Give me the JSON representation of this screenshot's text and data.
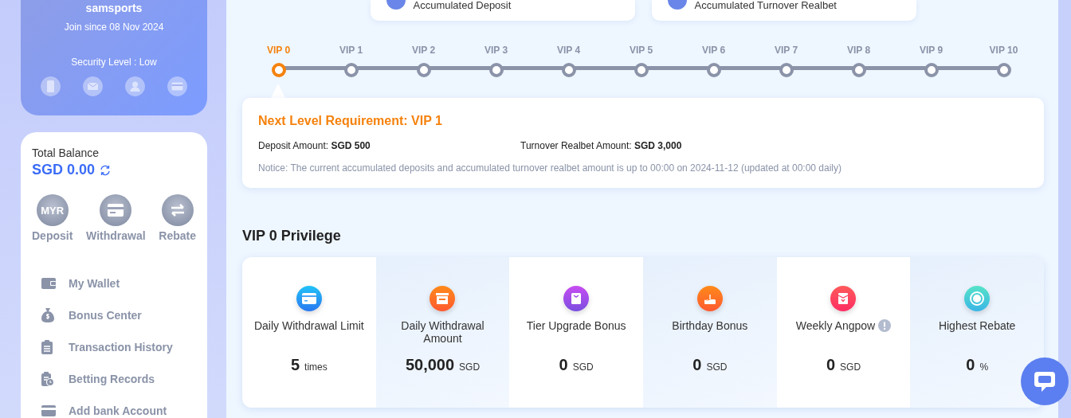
{
  "profile": {
    "username": "samsports",
    "joined": "Join since 08 Nov 2024",
    "security_level": "Security Level : Low"
  },
  "balance": {
    "label": "Total Balance",
    "amount": "SGD 0.00",
    "actions": [
      {
        "kind": "currency",
        "label": "Deposit",
        "badge": "MYR"
      },
      {
        "kind": "card",
        "label": "Withdrawal"
      },
      {
        "kind": "transfer",
        "label": "Rebate"
      }
    ]
  },
  "menu": [
    {
      "kind": "wallet",
      "label": "My Wallet"
    },
    {
      "kind": "moneybag",
      "label": "Bonus Center"
    },
    {
      "kind": "clipboard",
      "label": "Transaction History"
    },
    {
      "kind": "records",
      "label": "Betting Records"
    },
    {
      "kind": "bankcard",
      "label": "Add bank Account"
    }
  ],
  "stat_cards": [
    {
      "label": "Accumulated Deposit"
    },
    {
      "label": "Accumulated Turnover Realbet"
    }
  ],
  "vip_levels": [
    {
      "label": "VIP 0",
      "selected": true
    },
    {
      "label": "VIP 1",
      "selected": false
    },
    {
      "label": "VIP 2",
      "selected": false
    },
    {
      "label": "VIP 3",
      "selected": false
    },
    {
      "label": "VIP 4",
      "selected": false
    },
    {
      "label": "VIP 5",
      "selected": false
    },
    {
      "label": "VIP 6",
      "selected": false
    },
    {
      "label": "VIP 7",
      "selected": false
    },
    {
      "label": "VIP 8",
      "selected": false
    },
    {
      "label": "VIP 9",
      "selected": false
    },
    {
      "label": "VIP 10",
      "selected": false
    }
  ],
  "requirement": {
    "title": "Next Level Requirement: VIP 1",
    "deposit": "Deposit Amount: **SGD 500**",
    "turnover": "Turnover Realbet Amount: **SGD 3,000**",
    "notice": "Notice: The current accumulated deposits and accumulated turnover realbet amount is up to 00:00 on 2024-11-12 (updated at 00:00 daily)"
  },
  "privilege": {
    "title": "VIP 0 Privilege",
    "items": [
      {
        "kind": "card",
        "label": "Daily Withdrawal Limit",
        "value": "5",
        "unit": "times",
        "info": false
      },
      {
        "kind": "box",
        "label": "Daily Withdrawal Amount",
        "value": "50,000",
        "unit": "SGD",
        "info": false
      },
      {
        "kind": "gift",
        "label": "Tier Upgrade Bonus",
        "value": "0",
        "unit": "SGD",
        "info": false
      },
      {
        "kind": "cake",
        "label": "Birthday Bonus",
        "value": "0",
        "unit": "SGD",
        "info": false
      },
      {
        "kind": "envelope",
        "label": "Weekly Angpow",
        "value": "0",
        "unit": "SGD",
        "info": true
      },
      {
        "kind": "rebate",
        "label": "Highest Rebate",
        "value": "0",
        "unit": "%",
        "info": false
      }
    ]
  }
}
